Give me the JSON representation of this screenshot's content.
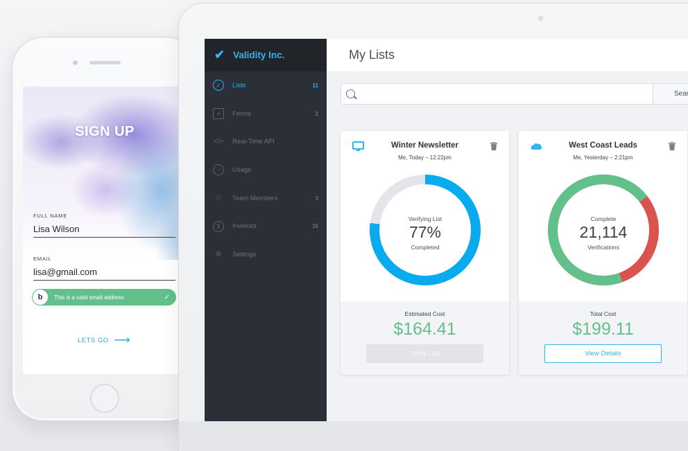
{
  "phone": {
    "title": "SIGN UP",
    "name_label": "FULL NAME",
    "name_value": "Lisa Wilson",
    "email_label": "EMAIL",
    "email_value": "lisa@gmail.com",
    "validation_text": "This is a valid email address",
    "cta": "LETS GO"
  },
  "app": {
    "brand": "Validity Inc.",
    "page_title": "My Lists",
    "accent": "#2fb6ef",
    "success": "#62c18b",
    "danger": "#d9534f"
  },
  "sidebar": {
    "items": [
      {
        "label": "Lists",
        "count": "11",
        "icon": "check-circle-icon",
        "active": true
      },
      {
        "label": "Forms",
        "count": "2",
        "icon": "clipboard-icon",
        "active": false
      },
      {
        "label": "Real-Time API",
        "count": "",
        "icon": "code-icon",
        "active": false
      },
      {
        "label": "Usage",
        "count": "",
        "icon": "pie-chart-icon",
        "active": false
      },
      {
        "label": "Team Members",
        "count": "3",
        "icon": "users-icon",
        "active": false
      },
      {
        "label": "Invoices",
        "count": "16",
        "icon": "dollar-icon",
        "active": false
      },
      {
        "label": "Settings",
        "count": "",
        "icon": "gear-icon",
        "active": false
      }
    ]
  },
  "search": {
    "placeholder": "",
    "button_label": "Sear"
  },
  "cards": [
    {
      "title": "Winter Newsletter",
      "subtitle": "Me, Today – 12:22pm",
      "source_icon": "monitor-icon",
      "status_top": "Verifying List",
      "status_value": "77%",
      "status_bottom": "Completed",
      "progress": 0.77,
      "cost_label": "Estimated Cost",
      "cost_value": "$164.41",
      "button_label": "Verify List",
      "button_enabled": false
    },
    {
      "title": "West Coast Leads",
      "subtitle": "Me, Yesterday – 2:21pm",
      "source_icon": "salesforce-cloud-icon",
      "status_top": "Complete",
      "status_value": "21,114",
      "status_bottom": "Verifications",
      "good_fraction": 0.7,
      "cost_label": "Total Cost",
      "cost_value": "$199.11",
      "button_label": "View Details",
      "button_enabled": true
    }
  ]
}
